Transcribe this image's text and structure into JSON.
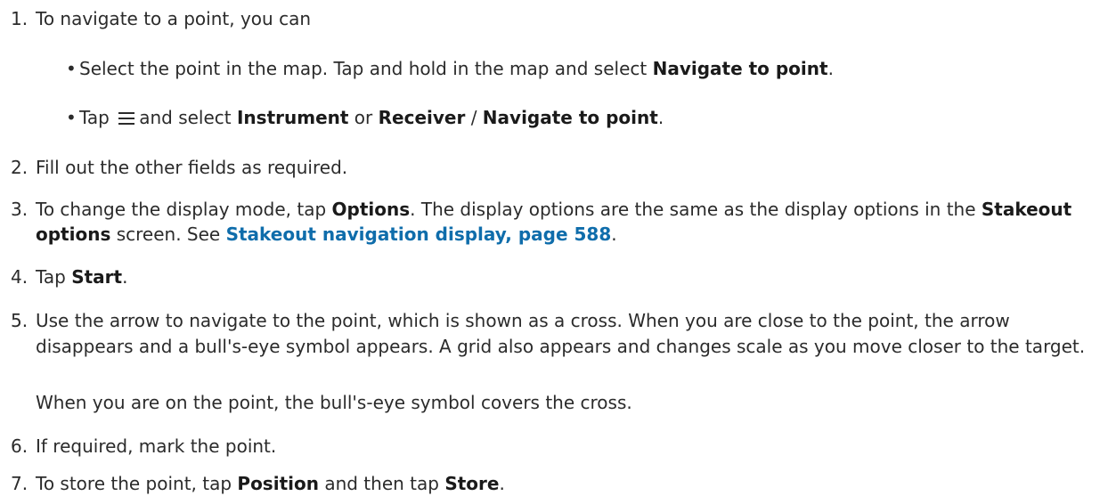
{
  "steps": [
    {
      "num": "1.",
      "text": "To navigate to a point, you can"
    },
    {
      "num": "2.",
      "text": "Fill out the other fields as required."
    },
    {
      "num": "3.",
      "t1": "To change the display mode, tap ",
      "b1": "Options",
      "t2": ". The display options are the same as the display options in the ",
      "b2": "Stakeout options",
      "t3": " screen. See ",
      "link": "Stakeout navigation display, page 588",
      "t4": "."
    },
    {
      "num": "4.",
      "t1": "Tap ",
      "b1": "Start",
      "t2": "."
    },
    {
      "num": "5.",
      "text": "Use the arrow to navigate to the point, which is shown as a cross. When you are close to the point, the arrow disappears and a bull's-eye symbol appears. A grid also appears and changes scale as you move closer to the target.",
      "note": "When you are on the point, the bull's-eye symbol covers the cross."
    },
    {
      "num": "6.",
      "text": "If required, mark the point."
    },
    {
      "num": "7.",
      "t1": "To store the point, tap ",
      "b1": "Position",
      "t2": " and then tap ",
      "b2": "Store",
      "t3": "."
    }
  ],
  "bullets": [
    {
      "t1": "Select the point in the map. Tap and hold in the map and select ",
      "b1": "Navigate to point",
      "t2": "."
    },
    {
      "t1": "Tap ",
      "icon": "menu-icon",
      "t2": "and select ",
      "b1": "Instrument",
      "t3": " or ",
      "b2": "Receiver",
      "t4": " / ",
      "b3": "Navigate to point",
      "t5": "."
    }
  ],
  "bullet_glyph": "•"
}
